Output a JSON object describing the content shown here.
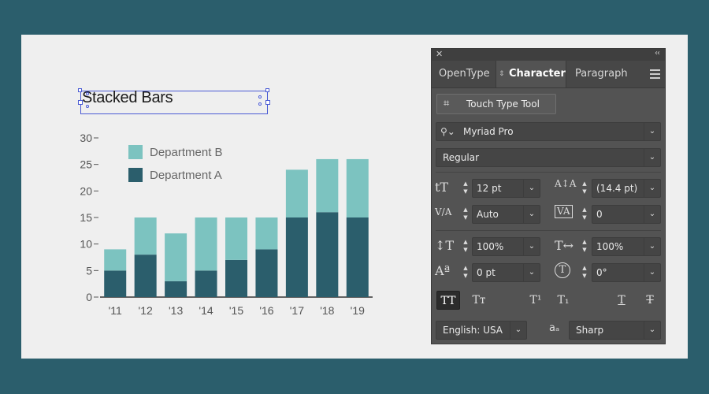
{
  "chart_title": "Stacked Bars",
  "chart_data": {
    "type": "bar",
    "stacked": true,
    "title": "Stacked Bars",
    "categories": [
      "'11",
      "'12",
      "'13",
      "'14",
      "'15",
      "'16",
      "'17",
      "'18",
      "'19"
    ],
    "series": [
      {
        "name": "Department A",
        "values": [
          5,
          8,
          3,
          5,
          7,
          9,
          15,
          16,
          15
        ],
        "color": "#2b5e6c"
      },
      {
        "name": "Department B",
        "values": [
          4,
          7,
          9,
          10,
          8,
          6,
          9,
          10,
          11
        ],
        "color": "#7cc3c0"
      }
    ],
    "ylim": [
      0,
      30
    ],
    "yticks": [
      "0",
      "5",
      "10",
      "15",
      "20",
      "25",
      "30"
    ],
    "legend_order": [
      "Department B",
      "Department A"
    ],
    "legend_placement": "top-left",
    "grid": false
  },
  "panel": {
    "close_glyph": "✕",
    "collapse_glyph": "‹‹",
    "tabs": [
      {
        "label": "OpenType"
      },
      {
        "label": "Character"
      },
      {
        "label": "Paragraph"
      }
    ],
    "touch_type_label": "Touch Type Tool",
    "font_family": "Myriad Pro",
    "font_style": "Regular",
    "font_size": "12 pt",
    "leading": "(14.4 pt)",
    "kerning": "Auto",
    "tracking": "0",
    "vertical_scale": "100%",
    "horizontal_scale": "100%",
    "baseline_shift": "0 pt",
    "rotation": "0°",
    "language": "English: USA",
    "antialias": "Sharp",
    "antialias_icon": "aₐ"
  },
  "icons": {
    "font_size": "tT",
    "leading": "A↕A",
    "kerning": "V/A",
    "tracking": "VA",
    "vertical_scale": "↕T",
    "horizontal_scale": "T↔",
    "baseline_shift": "Aª",
    "rotation": "T",
    "all_caps": "TT",
    "small_caps": "Tт",
    "superscript": "T¹",
    "subscript": "T₁",
    "underline": "T",
    "strikethrough": "T"
  }
}
